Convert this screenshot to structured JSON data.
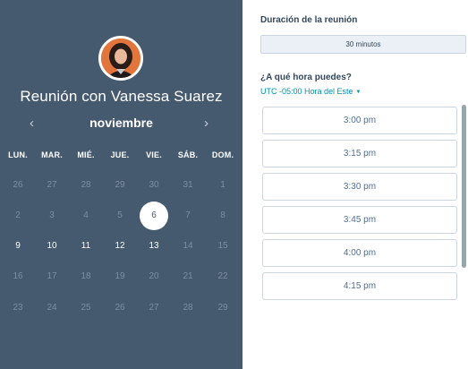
{
  "calendar": {
    "host_title": "Reunión con Vanessa Suarez",
    "month": "noviembre",
    "prev_icon": "chevron-left-icon",
    "next_icon": "chevron-right-icon",
    "weekdays": [
      "LUN.",
      "MAR.",
      "MIÉ.",
      "JUE.",
      "VIE.",
      "SÁB.",
      "DOM."
    ],
    "weeks": [
      [
        "26",
        "27",
        "28",
        "29",
        "30",
        "31",
        "1"
      ],
      [
        "2",
        "3",
        "4",
        "5",
        "6",
        "7",
        "8"
      ],
      [
        "9",
        "10",
        "11",
        "12",
        "13",
        "14",
        "15"
      ],
      [
        "16",
        "17",
        "18",
        "19",
        "20",
        "21",
        "22"
      ],
      [
        "23",
        "24",
        "25",
        "26",
        "27",
        "28",
        "29"
      ]
    ],
    "selected_day": "6",
    "available_days": [
      "9",
      "10",
      "11",
      "12",
      "13"
    ]
  },
  "booking": {
    "duration_label": "Duración de la reunión",
    "duration_value": "30 minutos",
    "time_question": "¿A qué hora puedes?",
    "timezone": "UTC -05:00 Hora del Este",
    "timezone_icon": "caret-down-icon",
    "slots": [
      "3:00 pm",
      "3:15 pm",
      "3:30 pm",
      "3:45 pm",
      "4:00 pm",
      "4:15 pm"
    ]
  },
  "colors": {
    "panel": "#45596f",
    "accent_link": "#0091ae",
    "slot_text": "#516f90",
    "avatar_ring": "#ffffff",
    "avatar_bg": "#e2753b"
  }
}
